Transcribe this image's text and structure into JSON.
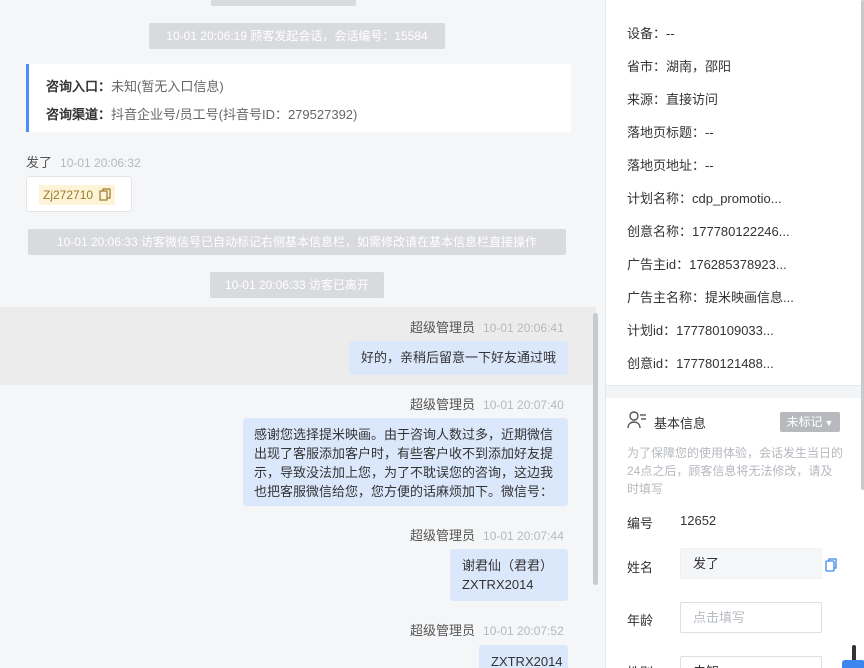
{
  "chat": {
    "system_messages": [
      "10-01 20:06:19 顾客发起会话，会话编号：15584",
      "10-01 20:06:33 访客微信号已自动标记右侧基本信息栏，如需修改请在基本信息栏直接操作",
      "10-01 20:06:33 访客已离开"
    ],
    "entry_card": {
      "entry_label": "咨询入口：",
      "entry_value": "未知(暂无入口信息)",
      "channel_label": "咨询渠道：",
      "channel_value": "抖音企业号/员工号(抖音号ID：279527392)"
    },
    "visitor_msg": {
      "sender": "发了",
      "time": "10-01 20:06:32",
      "wechat_tag": "Zj272710"
    },
    "agent_messages": [
      {
        "sender": "超级管理员",
        "time": "10-01 20:06:41",
        "text": "好的，亲稍后留意一下好友通过哦"
      },
      {
        "sender": "超级管理员",
        "time": "10-01 20:07:40",
        "lines": [
          "感谢您选择提米映画。由于咨询人数过多，近期微信",
          "出现了客服添加客户时，有些客户收不到添加好友提",
          "示，导致没法加上您，为了不耽误您的咨询，这边我",
          "也把客服微信给您，您方便的话麻烦加下。微信号："
        ]
      },
      {
        "sender": "超级管理员",
        "time": "10-01 20:07:44",
        "lines": [
          "谢君仙（君君）",
          "ZXTRX2014"
        ]
      },
      {
        "sender": "超级管理员",
        "time": "10-01 20:07:52",
        "text": "ZXTRX2014"
      }
    ]
  },
  "side": {
    "info_rows": [
      "设备：--",
      "省市：湖南，邵阳",
      "来源：直接访问",
      "落地页标题：--",
      "落地页地址：--",
      "计划名称：cdp_promotio...",
      "创意名称：177780122246...",
      "广告主id：176285378923...",
      "广告主名称：提米映画信息...",
      "计划id：177780109033...",
      "创意id：177780121488..."
    ],
    "basic_title": "基本信息",
    "mark_badge": "未标记",
    "hint": "为了保障您的使用体验，会话发生当日的24点之后，顾客信息将无法修改，请及时填写",
    "id_label": "编号",
    "id_value": "12652",
    "name_label": "姓名",
    "name_value": "发了",
    "age_label": "年龄",
    "age_placeholder": "点击填写",
    "gender_label": "性别",
    "gender_value": "未知"
  }
}
